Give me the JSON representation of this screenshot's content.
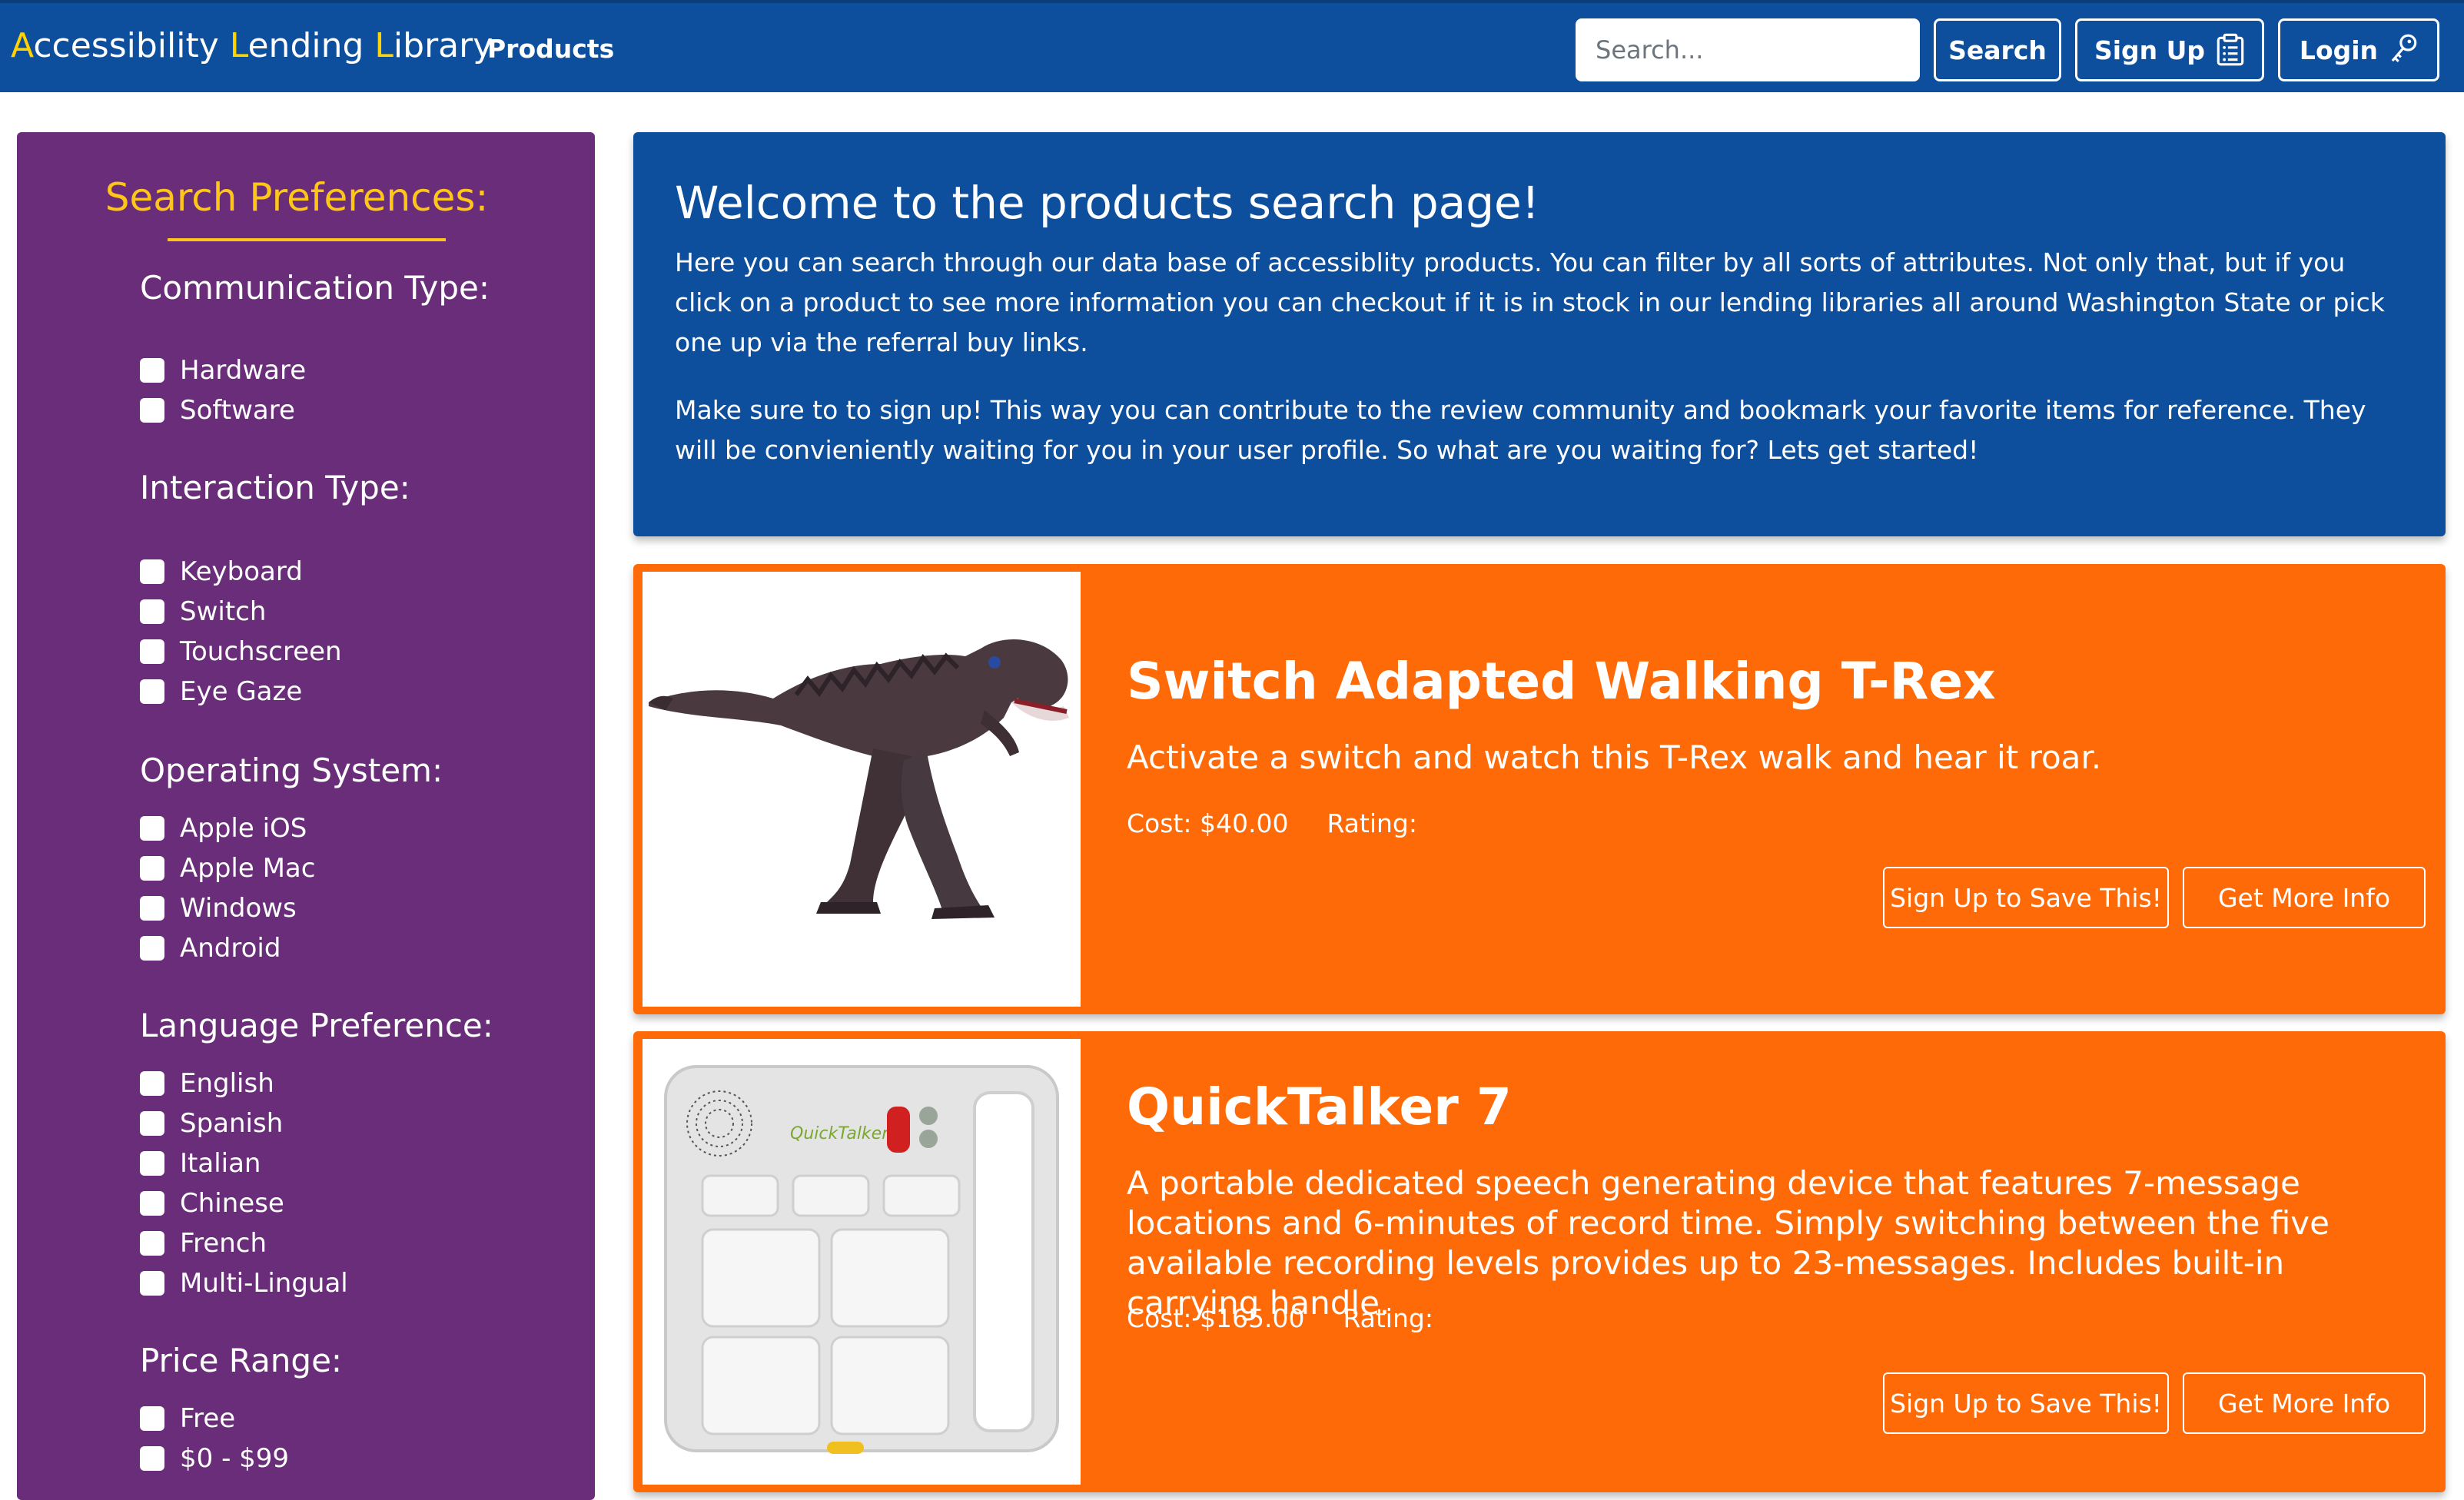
{
  "navbar": {
    "brand_parts": [
      "A",
      "ccessibility ",
      "L",
      "ending ",
      "L",
      "ibrary"
    ],
    "products_link": "Products",
    "search_placeholder": "Search...",
    "search_button": "Search",
    "signup_button": "Sign Up",
    "login_button": "Login",
    "icons": {
      "signup": "clipboard-icon",
      "login": "key-icon"
    },
    "colors": {
      "background": "#0d4f9c",
      "brand_highlight": "#ffd200"
    }
  },
  "sidebar": {
    "title": "Search Preferences:",
    "colors": {
      "background": "#6a2d7a",
      "title": "#ffc61a"
    },
    "groups": [
      {
        "heading": "Communication Type:",
        "options": [
          "Hardware",
          "Software"
        ]
      },
      {
        "heading": "Interaction Type:",
        "options": [
          "Keyboard",
          "Switch",
          "Touchscreen",
          "Eye Gaze"
        ]
      },
      {
        "heading": "Operating System:",
        "options": [
          "Apple iOS",
          "Apple Mac",
          "Windows",
          "Android"
        ]
      },
      {
        "heading": "Language Preference:",
        "options": [
          "English",
          "Spanish",
          "Italian",
          "Chinese",
          "French",
          "Multi-Lingual"
        ]
      },
      {
        "heading": "Price Range:",
        "options": [
          "Free",
          "$0 - $99"
        ]
      }
    ]
  },
  "welcome": {
    "title": "Welcome to the products search page!",
    "paragraph1": "Here you can search through our data base of accessiblity products. You can filter by all sorts of attributes. Not only that, but if you click on a product to see more information you can checkout if it is in stock in our lending libraries all around Washington State or pick one up via the referral buy links.",
    "paragraph2": "Make sure to to sign up! This way you can contribute to the review community and bookmark your favorite items for reference. They will be convieniently waiting for you in your user profile. So what are you waiting for? Lets get started!"
  },
  "products": [
    {
      "title": "Switch Adapted Walking T-Rex",
      "description": "Activate a switch and watch this T-Rex walk and hear it roar.",
      "cost": "Cost: $40.00",
      "rating_label": "Rating:",
      "save_button": "Sign Up to Save This!",
      "info_button": "Get More Info",
      "image": "t-rex-toy-image"
    },
    {
      "title": "QuickTalker 7",
      "description": "A portable dedicated speech generating device that features 7-message locations and 6-minutes of record time. Simply switching between the five available recording levels provides up to 23-messages. Includes built-in carrying handle.",
      "cost": "Cost: $165.00",
      "rating_label": "Rating:",
      "save_button": "Sign Up to Save This!",
      "info_button": "Get More Info",
      "image": "quicktalker-device-image",
      "image_logo_text": "QuickTalker"
    }
  ],
  "card_color": "#ff6a08"
}
